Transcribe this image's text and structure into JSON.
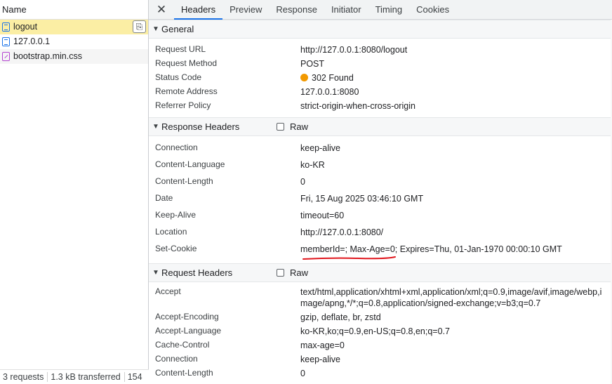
{
  "request_list": {
    "header": "Name",
    "items": [
      {
        "name": "logout",
        "type": "document",
        "selected": true
      },
      {
        "name": "127.0.0.1",
        "type": "document",
        "selected": false
      },
      {
        "name": "bootstrap.min.css",
        "type": "stylesheet",
        "selected": false
      }
    ],
    "footer": {
      "requests": "3 requests",
      "transferred": "1.3 kB transferred",
      "resources": "154"
    }
  },
  "tabs": [
    "Headers",
    "Preview",
    "Response",
    "Initiator",
    "Timing",
    "Cookies"
  ],
  "active_tab": "Headers",
  "general": {
    "title": "General",
    "rows": [
      {
        "key": "Request URL",
        "value": "http://127.0.0.1:8080/logout"
      },
      {
        "key": "Request Method",
        "value": "POST"
      },
      {
        "key": "Status Code",
        "value": "302 Found"
      },
      {
        "key": "Remote Address",
        "value": "127.0.0.1:8080"
      },
      {
        "key": "Referrer Policy",
        "value": "strict-origin-when-cross-origin"
      }
    ]
  },
  "response_headers": {
    "title": "Response Headers",
    "raw_label": "Raw",
    "rows": [
      {
        "key": "Connection",
        "value": "keep-alive"
      },
      {
        "key": "Content-Language",
        "value": "ko-KR"
      },
      {
        "key": "Content-Length",
        "value": "0"
      },
      {
        "key": "Date",
        "value": "Fri, 15 Aug 2025 03:46:10 GMT"
      },
      {
        "key": "Keep-Alive",
        "value": "timeout=60"
      },
      {
        "key": "Location",
        "value": "http://127.0.0.1:8080/"
      },
      {
        "key": "Set-Cookie",
        "value": "memberId=; Max-Age=0; Expires=Thu, 01-Jan-1970 00:00:10 GMT"
      }
    ]
  },
  "request_headers": {
    "title": "Request Headers",
    "raw_label": "Raw",
    "rows": [
      {
        "key": "Accept",
        "value": "text/html,application/xhtml+xml,application/xml;q=0.9,image/avif,image/webp,image/apng,*/*;q=0.8,application/signed-exchange;v=b3;q=0.7"
      },
      {
        "key": "Accept-Encoding",
        "value": "gzip, deflate, br, zstd"
      },
      {
        "key": "Accept-Language",
        "value": "ko-KR,ko;q=0.9,en-US;q=0.8,en;q=0.7"
      },
      {
        "key": "Cache-Control",
        "value": "max-age=0"
      },
      {
        "key": "Connection",
        "value": "keep-alive"
      },
      {
        "key": "Content-Length",
        "value": "0"
      }
    ]
  },
  "colors": {
    "selected_row": "#fbeea4",
    "status_dot": "#f29900",
    "annotation_underline": "#e0161d",
    "active_tab_indicator": "#1a73e8"
  }
}
